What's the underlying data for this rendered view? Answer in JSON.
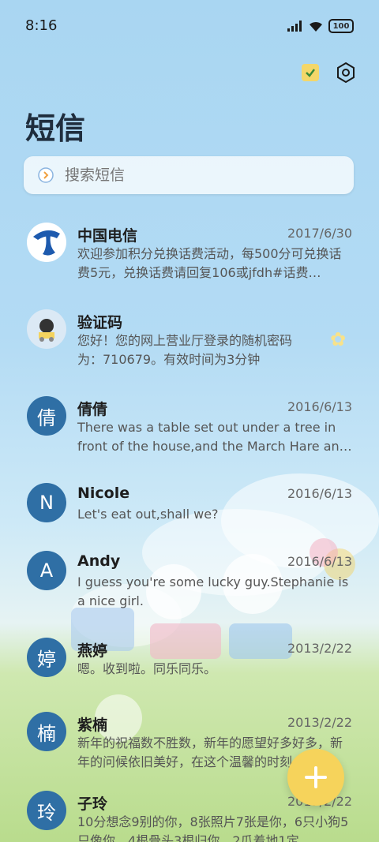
{
  "status_bar": {
    "time": "8:16",
    "battery": "100"
  },
  "header": {
    "title": "短信"
  },
  "search": {
    "placeholder": "搜索短信"
  },
  "messages": [
    {
      "name": "中国电信",
      "date": "2017/6/30",
      "preview": "欢迎参加积分兑换话费活动，每500分可兑换话费5元，兑换话费请回复106或jfdh#话费…",
      "avatar": ""
    },
    {
      "name": "验证码",
      "date": "",
      "preview": "您好！您的网上营业厅登录的随机密码为：710679。有效时间为3分钟",
      "avatar": ""
    },
    {
      "name": "倩倩",
      "date": "2016/6/13",
      "preview": "There was a table set out under a tree in front of the house,and the March Hare an…",
      "avatar": "倩"
    },
    {
      "name": "Nicole",
      "date": "2016/6/13",
      "preview": "Let's eat out,shall we?",
      "avatar": "N"
    },
    {
      "name": "Andy",
      "date": "2016/6/13",
      "preview": "I guess you're some lucky guy.Stephanie is a nice girl.",
      "avatar": "A"
    },
    {
      "name": "燕婷",
      "date": "2013/2/22",
      "preview": "嗯。收到啦。同乐同乐。",
      "avatar": "婷"
    },
    {
      "name": "紫楠",
      "date": "2013/2/22",
      "preview": "新年的祝福数不胜数，新年的愿望好多好多，新年的问候依旧美好，在这个温馨的时刻…",
      "avatar": "楠"
    },
    {
      "name": "子玲",
      "date": "2013/2/22",
      "preview": "10分想念9别的你，8张照片7张是你，6只小狗5只像你，4根骨头3根归你，2瓜着地1定",
      "avatar": "玲"
    }
  ],
  "colors": {
    "avatar": "#2f6fa5",
    "fab": "#f6d35b"
  }
}
